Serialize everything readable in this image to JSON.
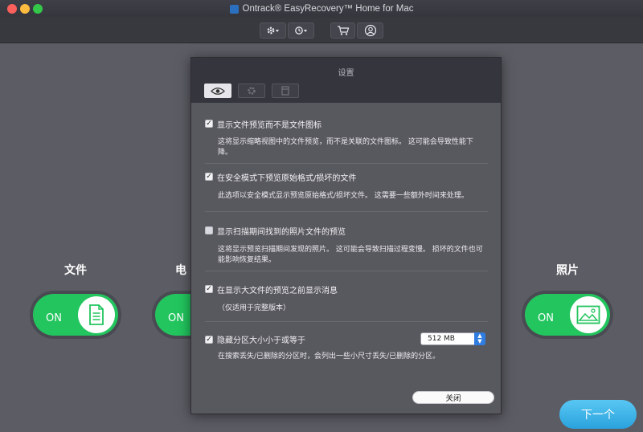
{
  "window": {
    "title": "Ontrack® EasyRecovery™ Home for Mac"
  },
  "toolbar": {
    "settings_icon": "gear-icon",
    "history_icon": "history-icon",
    "cart_icon": "cart-icon",
    "user_icon": "user-icon"
  },
  "categories": {
    "file_label": "文件",
    "mail_label": "电",
    "photo_label": "照片",
    "on_label": "ON"
  },
  "next_button": "下一个",
  "colors": {
    "toggle_on": "#22c55e",
    "next_button": "#2aa2dd",
    "checkbox_accent": "#2f7de1"
  },
  "settings_dialog": {
    "title": "设置",
    "tabs": [
      {
        "icon": "eye-icon",
        "active": true
      },
      {
        "icon": "gear-icon",
        "active": false
      },
      {
        "icon": "filter-icon",
        "active": false
      }
    ],
    "options": [
      {
        "label": "显示文件预览而不是文件图标",
        "checked": true,
        "description": "这将显示缩略视图中的文件预览，而不是关联的文件图标。 这可能会导致性能下降。"
      },
      {
        "label": "在安全模式下预览原始格式/损坏的文件",
        "checked": true,
        "description": "此选项以安全模式显示预览原始格式/损坏文件。 这需要一些额外时间来处理。"
      },
      {
        "label": "显示扫描期间找到的照片文件的预览",
        "checked": false,
        "description": "这将显示预览扫描期间发现的照片。 这可能会导致扫描过程变慢。 损坏的文件也可能影响恢复结果。"
      },
      {
        "label": "在显示大文件的预览之前显示消息",
        "checked": true,
        "description": "（仅适用于完整版本）"
      },
      {
        "label": "隐藏分区大小小于或等于",
        "checked": true,
        "description": "在搜索丢失/已删除的分区时，会列出一些小尺寸丢失/已删除的分区。"
      }
    ],
    "partition_size_value": "512 MB",
    "close_label": "关闭"
  }
}
